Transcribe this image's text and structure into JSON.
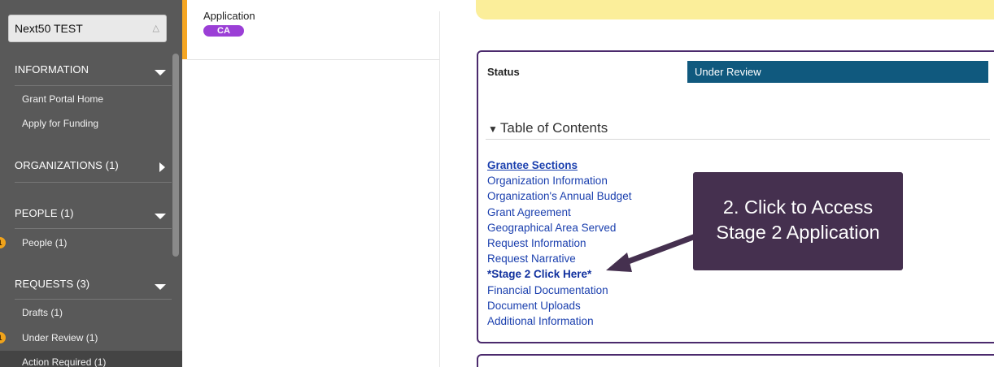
{
  "sidebar": {
    "org_selector": "Next50 TEST",
    "sections": {
      "information": "INFORMATION",
      "organizations": "ORGANIZATIONS (1)",
      "people": "PEOPLE (1)",
      "requests": "REQUESTS (3)"
    },
    "items": {
      "grant_portal_home": "Grant Portal Home",
      "apply_for_funding": "Apply for Funding",
      "people": "People  (1)",
      "drafts": "Drafts  (1)",
      "under_review": "Under Review  (1)",
      "action_required": "Action Required  (1)"
    },
    "badges": {
      "people": "1",
      "under_review": "1"
    }
  },
  "application_card": {
    "label": "Application",
    "tag": "CA"
  },
  "status": {
    "label": "Status",
    "value": "Under Review"
  },
  "toc": {
    "title": "Table of Contents",
    "links": [
      "Grantee Sections",
      "Organization Information",
      "Organization's Annual Budget",
      "Grant Agreement",
      "Geographical Area Served",
      "Request Information",
      "Request Narrative",
      "*Stage 2 Click Here*",
      "Financial Documentation",
      "Document Uploads",
      "Additional Information"
    ]
  },
  "callout": {
    "line1": "2. Click to Access",
    "line2": "Stage 2 Application"
  },
  "colors": {
    "sidebar_bg": "#595959",
    "accent_orange": "#f5a623",
    "ca_pill": "#9b3fd6",
    "status_bar": "#10597e",
    "panel_border": "#4b2a6d",
    "callout_bg": "#45304f",
    "link_blue": "#1a3fae",
    "notice_yellow": "#fbee9a"
  }
}
